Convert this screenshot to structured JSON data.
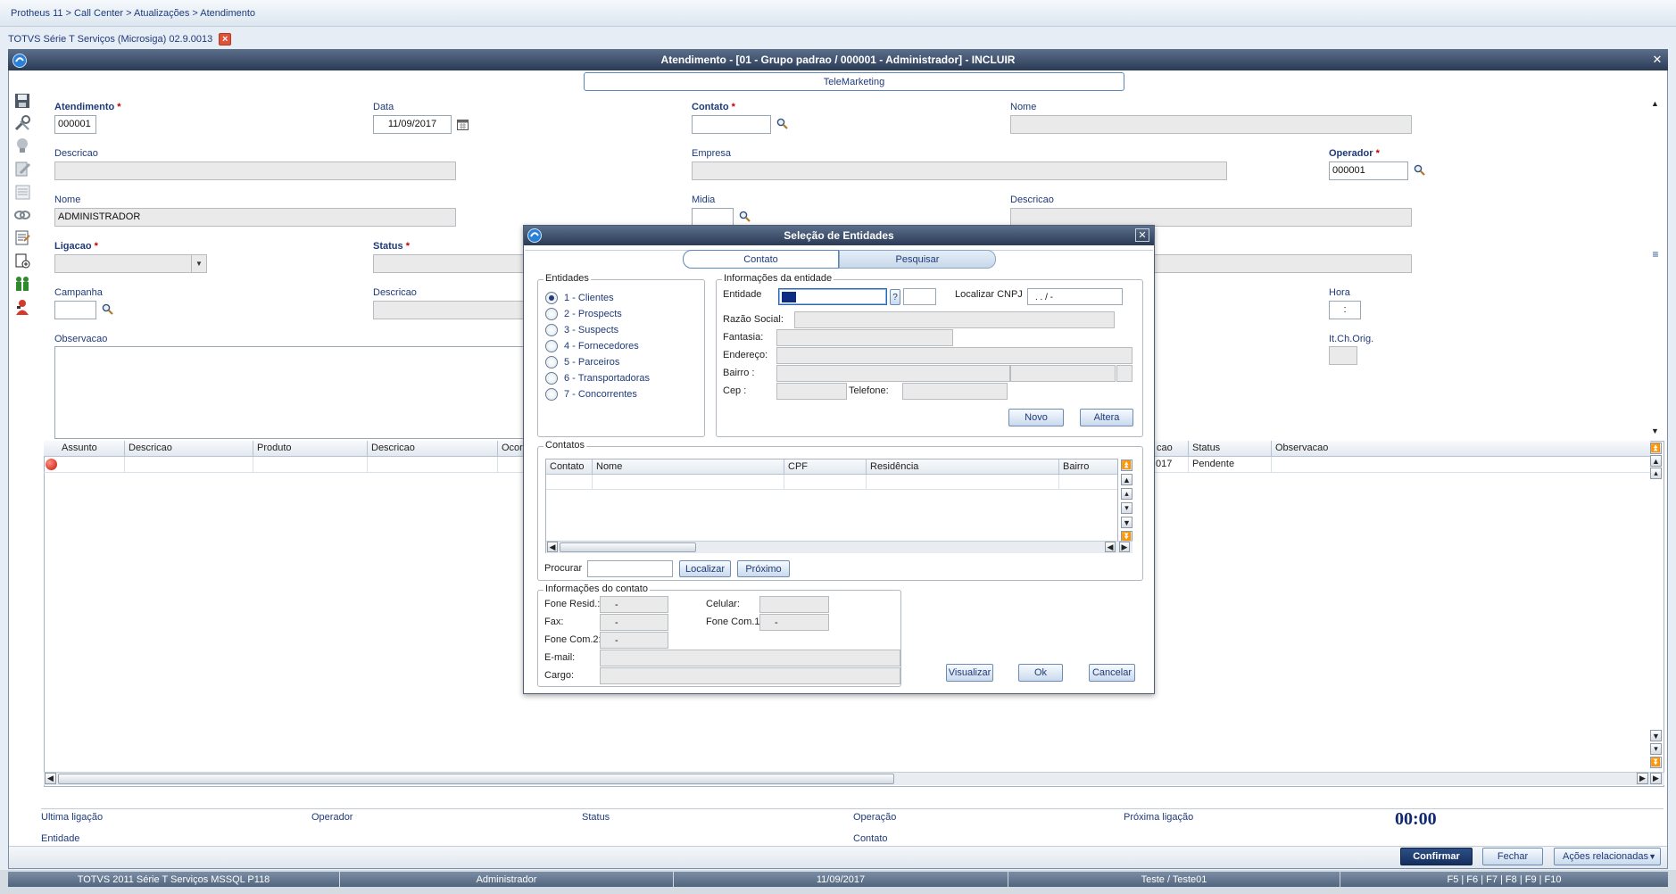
{
  "breadcrumb": "Protheus 11 > Call Center > Atualizações > Atendimento",
  "tab": {
    "label": "TOTVS Série T Serviços (Microsiga) 02.9.0013"
  },
  "window": {
    "title": "Atendimento - [01 - Grupo padrao / 000001 - Administrador] - INCLUIR",
    "telemarketing_tab": "TeleMarketing"
  },
  "form": {
    "atendimento": {
      "label": "Atendimento",
      "value": "000001"
    },
    "data": {
      "label": "Data",
      "value": "11/09/2017"
    },
    "contato": {
      "label": "Contato"
    },
    "nome_contato": {
      "label": "Nome"
    },
    "descricao1": {
      "label": "Descricao"
    },
    "empresa": {
      "label": "Empresa"
    },
    "operador": {
      "label": "Operador",
      "value": "000001"
    },
    "nome": {
      "label": "Nome",
      "value": "ADMINISTRADOR"
    },
    "midia": {
      "label": "Midia"
    },
    "descricao_midia": {
      "label": "Descricao"
    },
    "ligacao": {
      "label": "Ligacao"
    },
    "status": {
      "label": "Status"
    },
    "campanha": {
      "label": "Campanha"
    },
    "descricao_campanha": {
      "label": "Descricao"
    },
    "hora": {
      "label": "Hora",
      "value": ":"
    },
    "itchorig": {
      "label": "It.Ch.Orig."
    },
    "observacao": {
      "label": "Observacao"
    }
  },
  "grid": {
    "headers": [
      "Assunto",
      "Descricao",
      "Produto",
      "Descricao",
      "Ocor",
      "cao",
      "Status",
      "Observacao"
    ],
    "row": {
      "col5": "017",
      "status": "Pendente"
    }
  },
  "bottom": {
    "ultima_ligacao": "Ultima ligação",
    "operador": "Operador",
    "status": "Status",
    "operacao": "Operação",
    "proxima_ligacao": "Próxima ligação",
    "timer": "00:00",
    "entidade": "Entidade",
    "contato": "Contato",
    "confirmar": "Confirmar",
    "fechar": "Fechar",
    "acoes": "Ações relacionadas"
  },
  "statusbar": [
    "TOTVS 2011 Série T Serviços MSSQL P118",
    "Administrador",
    "11/09/2017",
    "Teste / Teste01",
    "F5 | F6 | F7 | F8 | F9 | F10"
  ],
  "dialog": {
    "title": "Seleção de Entidades",
    "tabs": [
      "Contato",
      "Pesquisar"
    ],
    "entidades_title": "Entidades",
    "entidades": [
      "1 - Clientes",
      "2 - Prospects",
      "3 - Suspects",
      "4 - Fornecedores",
      "5 - Parceiros",
      "6 - Transportadoras",
      "7 - Concorrentes"
    ],
    "info_title": "Informações da entidade",
    "entidade_label": "Entidade",
    "help_btn": "?",
    "cnpj_label": "Localizar CNPJ",
    "cnpj_value": " .  .  /  -",
    "razao_label": "Razão Social:",
    "fantasia_label": "Fantasia:",
    "endereco_label": "Endereço:",
    "bairro_label": "Bairro :",
    "cep_label": "Cep :",
    "telefone_label": "Telefone:",
    "novo": "Novo",
    "altera": "Altera",
    "contatos_title": "Contatos",
    "contatos_headers": [
      "Contato",
      "Nome",
      "CPF",
      "Residência",
      "Bairro"
    ],
    "procurar_label": "Procurar",
    "localizar": "Localizar",
    "proximo": "Próximo",
    "infocontato_title": "Informações do contato",
    "fone_resid": {
      "label": "Fone Resid.:",
      "value": "-"
    },
    "fax": {
      "label": "Fax:",
      "value": "-"
    },
    "fone_com2": {
      "label": "Fone Com.2:",
      "value": "-"
    },
    "celular": {
      "label": "Celular:",
      "value": ""
    },
    "fone_com1": {
      "label": "Fone Com.1:",
      "value": "-"
    },
    "email_label": "E-mail:",
    "cargo_label": "Cargo:",
    "visualizar": "Visualizar",
    "ok": "Ok",
    "cancelar": "Cancelar"
  }
}
